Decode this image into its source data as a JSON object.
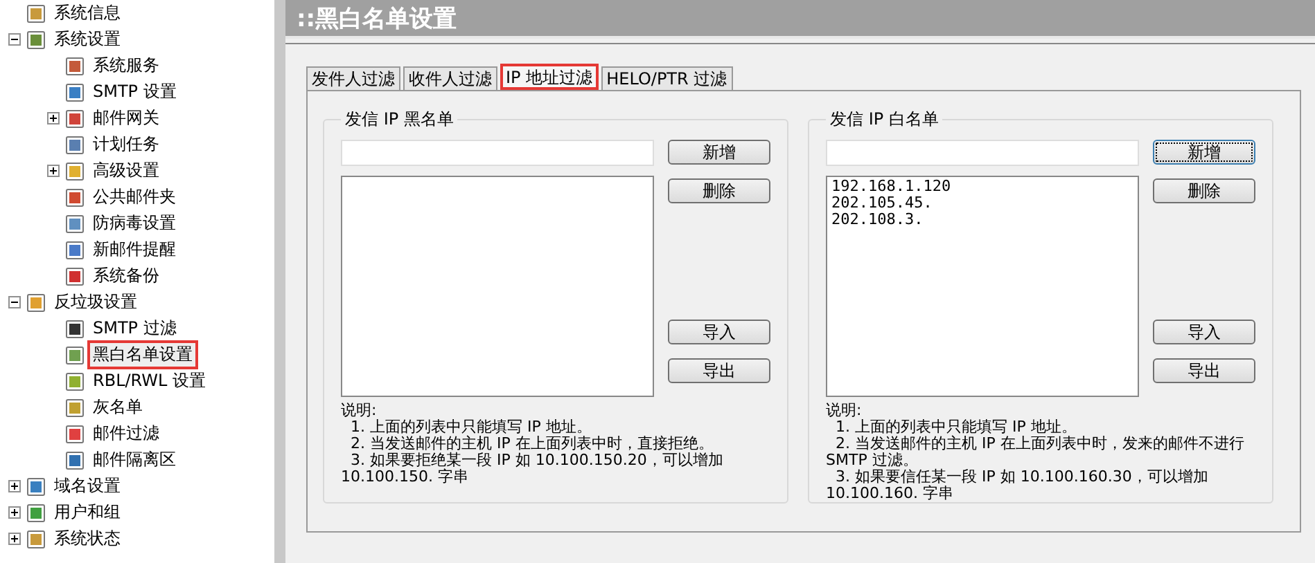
{
  "sidebar": {
    "tree": [
      {
        "label": "系统信息",
        "selected": false
      },
      {
        "label": "系统设置",
        "expanded": true,
        "selected": false,
        "children": [
          {
            "label": "系统服务",
            "selected": false
          },
          {
            "label": "SMTP 设置",
            "selected": false
          },
          {
            "label": "邮件网关",
            "expanded": false,
            "selected": false
          },
          {
            "label": "计划任务",
            "selected": false
          },
          {
            "label": "高级设置",
            "expanded": false,
            "selected": false
          },
          {
            "label": "公共邮件夹",
            "selected": false
          },
          {
            "label": "防病毒设置",
            "selected": false
          },
          {
            "label": "新邮件提醒",
            "selected": false
          },
          {
            "label": "系统备份",
            "selected": false
          }
        ]
      },
      {
        "label": "反垃圾设置",
        "expanded": true,
        "selected": false,
        "children": [
          {
            "label": "SMTP 过滤",
            "selected": false
          },
          {
            "label": "黑白名单设置",
            "selected": true
          },
          {
            "label": "RBL/RWL 设置",
            "selected": false
          },
          {
            "label": "灰名单",
            "selected": false
          },
          {
            "label": "邮件过滤",
            "selected": false
          },
          {
            "label": "邮件隔离区",
            "selected": false
          }
        ]
      },
      {
        "label": "域名设置",
        "expanded": false,
        "selected": false
      },
      {
        "label": "用户和组",
        "expanded": false,
        "selected": false
      },
      {
        "label": "系统状态",
        "expanded": false,
        "selected": false
      }
    ]
  },
  "page_title": "::黑白名单设置",
  "tabs": [
    {
      "label": "发件人过滤",
      "selected": false
    },
    {
      "label": "收件人过滤",
      "selected": false
    },
    {
      "label": "IP 地址过滤",
      "selected": true
    },
    {
      "label": "HELO/PTR 过滤",
      "selected": false
    }
  ],
  "groups": [
    {
      "title": "发信 IP 黑名单",
      "buttons": [
        {
          "label": "新增",
          "focused": false
        },
        {
          "label": "删除",
          "focused": false
        },
        {
          "label": "导入",
          "focused": false
        },
        {
          "label": "导出",
          "focused": false
        }
      ],
      "note": {
        "heading": "说明:",
        "lines": [
          "  1. 上面的列表中只能填写 IP 地址。",
          "  2. 当发送邮件的主机 IP 在上面列表中时，直接拒绝。",
          "  3. 如果要拒绝某一段 IP 如 10.100.150.20，可以增加10.100.150. 字串"
        ]
      }
    },
    {
      "title": "发信 IP 白名单",
      "list_items": [
        "192.168.1.120",
        "202.105.45.",
        "202.108.3."
      ],
      "buttons": [
        {
          "label": "新增",
          "focused": true
        },
        {
          "label": "删除",
          "focused": false
        },
        {
          "label": "导入",
          "focused": false
        },
        {
          "label": "导出",
          "focused": false
        }
      ],
      "note": {
        "heading": "说明:",
        "lines": [
          "  1. 上面的列表中只能填写 IP 地址。",
          "  2. 当发送邮件的主机 IP 在上面列表中时，发来的邮件不进行 SMTP 过滤。",
          "  3. 如果要信任某一段 IP 如 10.100.160.30，可以增加10.100.160. 字串"
        ]
      }
    }
  ]
}
